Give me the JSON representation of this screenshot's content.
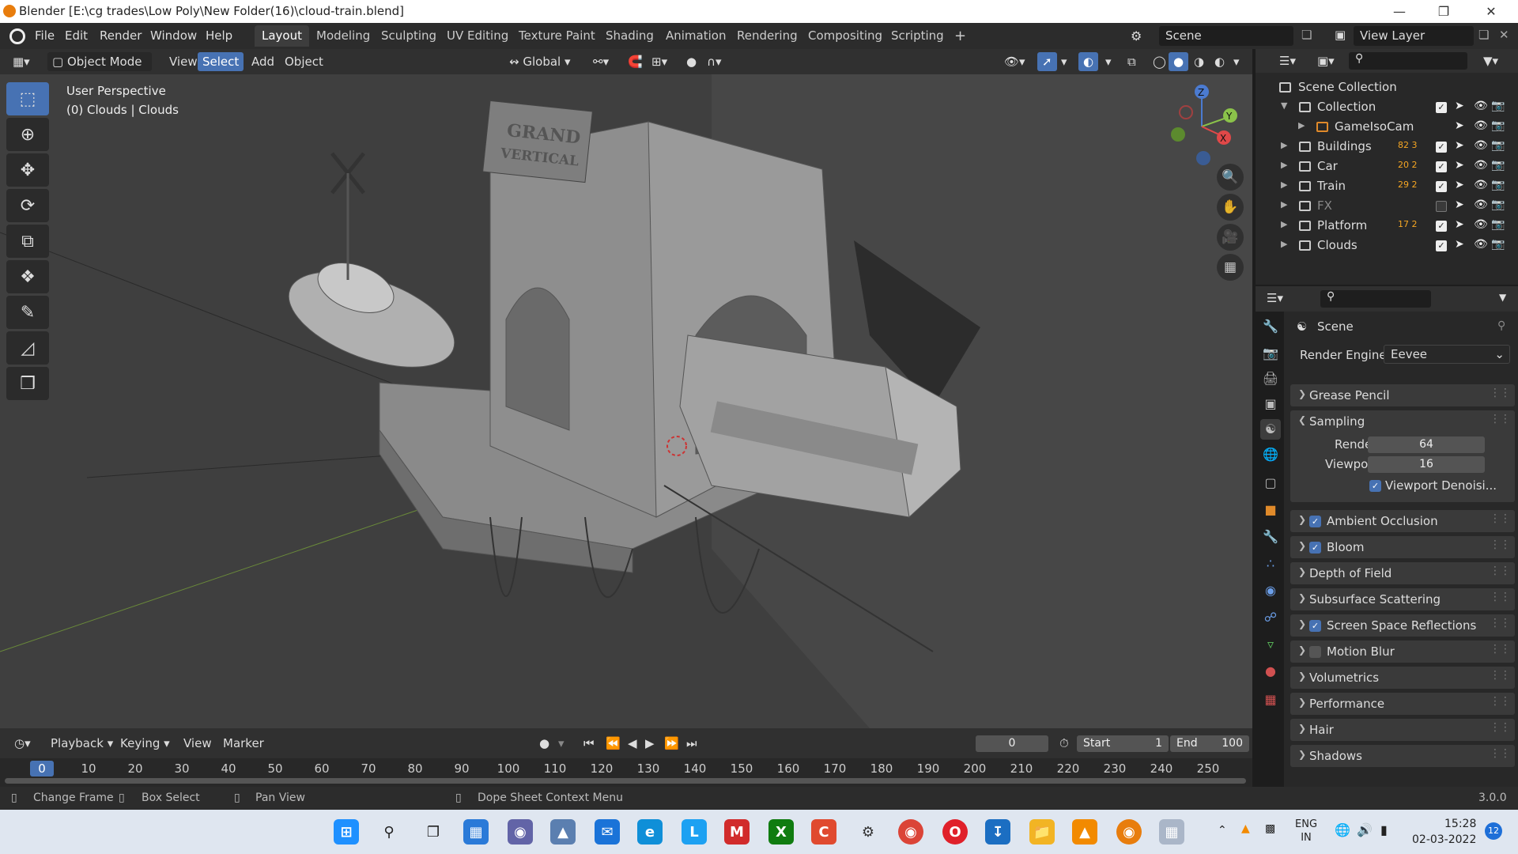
{
  "window": {
    "title": "Blender [E:\\cg trades\\Low Poly\\New Folder(16)\\cloud-train.blend]"
  },
  "menu": [
    "File",
    "Edit",
    "Render",
    "Window",
    "Help"
  ],
  "workspaces": [
    "Layout",
    "Modeling",
    "Sculpting",
    "UV Editing",
    "Texture Paint",
    "Shading",
    "Animation",
    "Rendering",
    "Compositing",
    "Scripting"
  ],
  "scene_name": "Scene",
  "view_layer": "View Layer",
  "viewport_header": {
    "mode": "Object Mode",
    "view": "View",
    "select": "Select",
    "add": "Add",
    "object": "Object",
    "transform": "Global"
  },
  "viewport": {
    "perspective": "User Perspective",
    "collection_info": "(0) Clouds | Clouds",
    "sign_top": "GRAND",
    "sign_bottom": "VERTICAL"
  },
  "gizmo": {
    "z": "Z",
    "y": "Y",
    "x": "X"
  },
  "outliner": {
    "root": "Scene Collection",
    "rows": [
      {
        "name": "Collection",
        "checked": true,
        "dim": false,
        "badge": ""
      },
      {
        "name": "GameIsoCam",
        "checked": null,
        "dim": false,
        "badge": ""
      },
      {
        "name": "Buildings",
        "checked": true,
        "dim": false,
        "badge": "82  3"
      },
      {
        "name": "Car",
        "checked": true,
        "dim": false,
        "badge": "20  2"
      },
      {
        "name": "Train",
        "checked": true,
        "dim": false,
        "badge": "29  2"
      },
      {
        "name": "FX",
        "checked": false,
        "dim": true,
        "badge": ""
      },
      {
        "name": "Platform",
        "checked": true,
        "dim": false,
        "badge": "17  2"
      },
      {
        "name": "Clouds",
        "checked": true,
        "dim": false,
        "badge": ""
      }
    ]
  },
  "properties": {
    "context": "Scene",
    "render_engine_label": "Render Engine",
    "render_engine": "Eevee",
    "sampling": {
      "title": "Sampling",
      "render_label": "Render",
      "render": "64",
      "viewport_label": "Viewport",
      "viewport": "16",
      "denoise": "Viewport Denoisi..."
    },
    "panels": [
      {
        "label": "Grease Pencil",
        "checkbox": null
      },
      {
        "label": "Ambient Occlusion",
        "checkbox": true
      },
      {
        "label": "Bloom",
        "checkbox": true
      },
      {
        "label": "Depth of Field",
        "checkbox": null
      },
      {
        "label": "Subsurface Scattering",
        "checkbox": null
      },
      {
        "label": "Screen Space Reflections",
        "checkbox": true
      },
      {
        "label": "Motion Blur",
        "checkbox": false
      },
      {
        "label": "Volumetrics",
        "checkbox": null
      },
      {
        "label": "Performance",
        "checkbox": null
      },
      {
        "label": "Hair",
        "checkbox": null
      },
      {
        "label": "Shadows",
        "checkbox": null
      }
    ]
  },
  "timeline": {
    "menus": [
      "Playback",
      "Keying",
      "View",
      "Marker"
    ],
    "current_frame": "0",
    "start_label": "Start",
    "start": "1",
    "end_label": "End",
    "end": "100",
    "ticks": [
      "0",
      "10",
      "20",
      "30",
      "40",
      "50",
      "60",
      "70",
      "80",
      "90",
      "100",
      "110",
      "120",
      "130",
      "140",
      "150",
      "160",
      "170",
      "180",
      "190",
      "200",
      "210",
      "220",
      "230",
      "240",
      "250"
    ]
  },
  "statusbar": {
    "change_frame": "Change Frame",
    "box_select": "Box Select",
    "pan_view": "Pan View",
    "context_menu": "Dope Sheet Context Menu",
    "version": "3.0.0"
  },
  "taskbar": {
    "lang1": "ENG",
    "lang2": "IN",
    "time": "15:28",
    "date": "02-03-2022",
    "notif": "12"
  }
}
